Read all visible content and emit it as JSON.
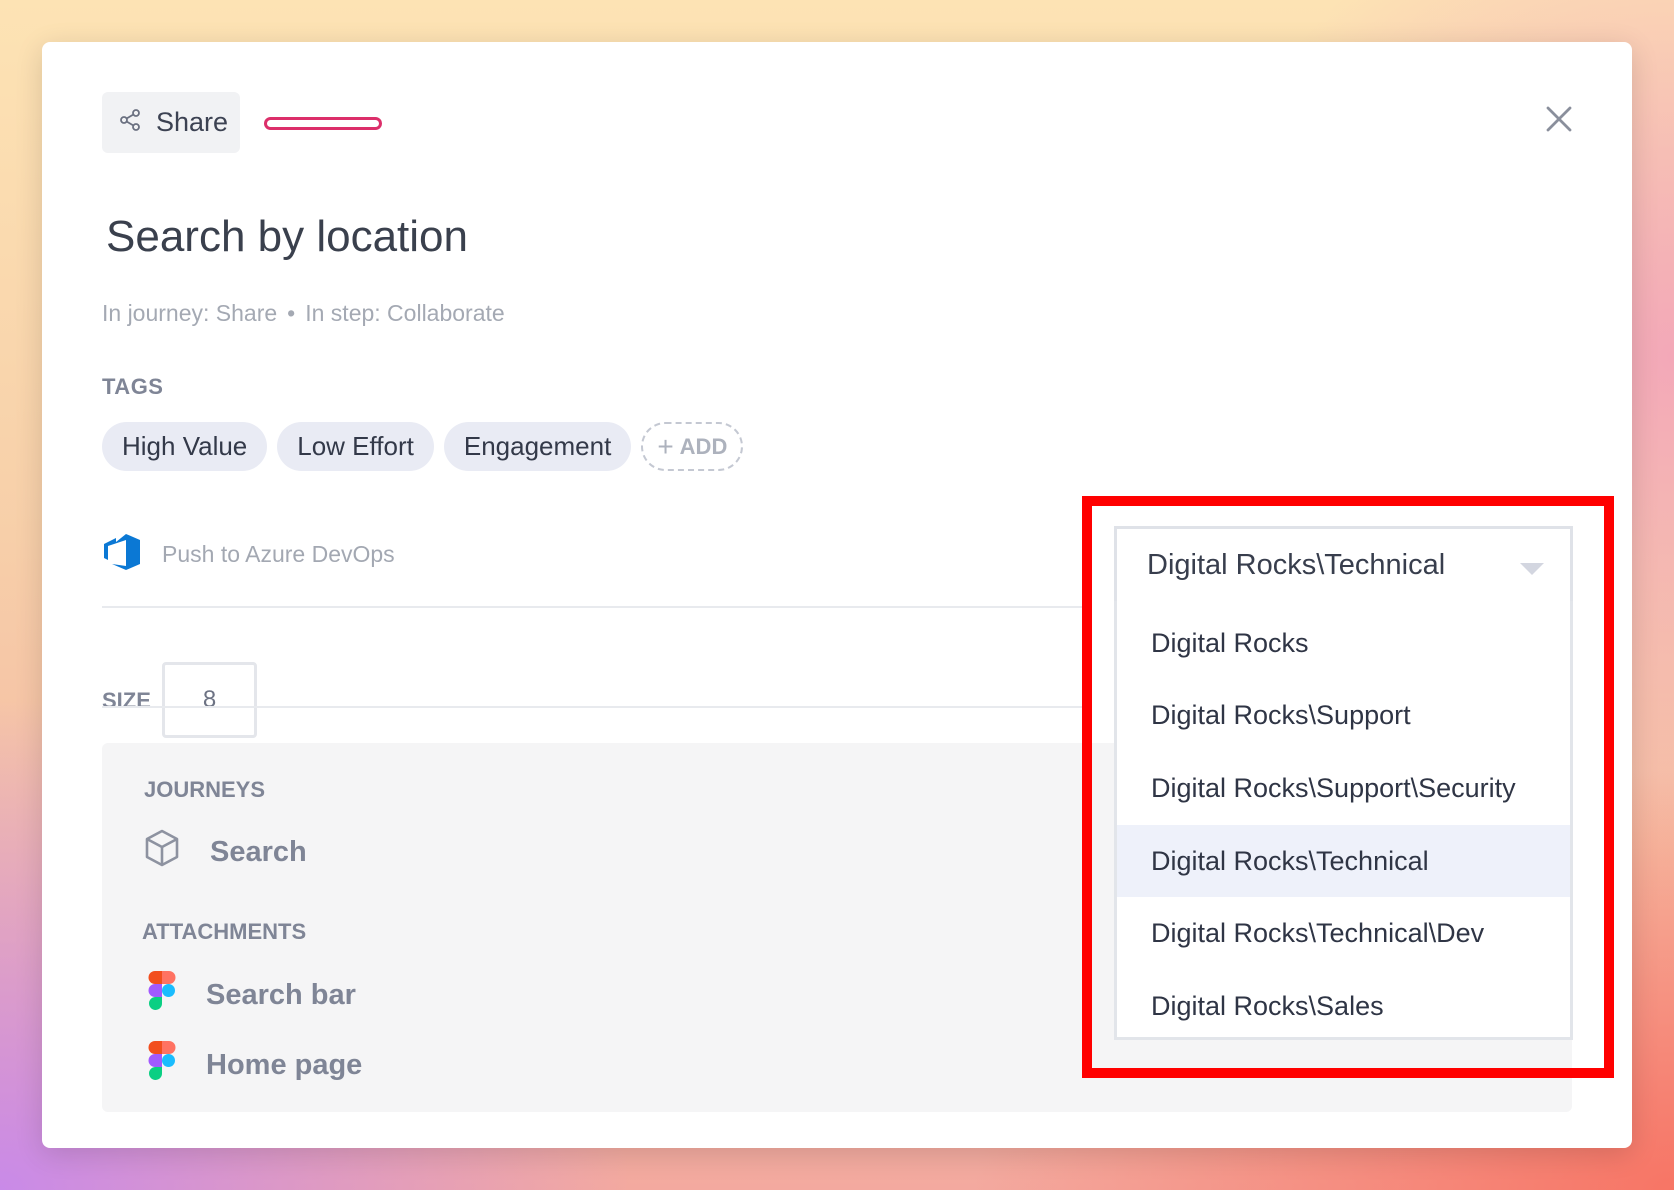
{
  "header": {
    "share_label": "Share"
  },
  "card": {
    "title": "Search by location",
    "journey_text": "In journey: Share",
    "separator": "•",
    "step_text": "In step: Collaborate"
  },
  "tags": {
    "label": "TAGS",
    "items": [
      "High Value",
      "Low Effort",
      "Engagement"
    ],
    "add_label": "ADD"
  },
  "azure": {
    "push_label": "Push to Azure DevOps",
    "selected_area": "Digital Rocks\\Technical",
    "options": [
      "Digital Rocks",
      "Digital Rocks\\Support",
      "Digital Rocks\\Support\\Security",
      "Digital Rocks\\Technical",
      "Digital Rocks\\Technical\\Dev",
      "Digital Rocks\\Sales"
    ],
    "highlighted_index": 3
  },
  "size": {
    "label": "SIZE",
    "value": "8"
  },
  "journeys": {
    "label": "JOURNEYS",
    "items": [
      "Search"
    ]
  },
  "attachments": {
    "label": "ATTACHMENTS",
    "items": [
      "Search bar",
      "Home page"
    ]
  },
  "colors": {
    "highlight_box": "#ff0000",
    "tag_bg": "#e9ebf4",
    "accent_pink": "#dc2f6a",
    "azure_blue": "#0b78d4"
  }
}
